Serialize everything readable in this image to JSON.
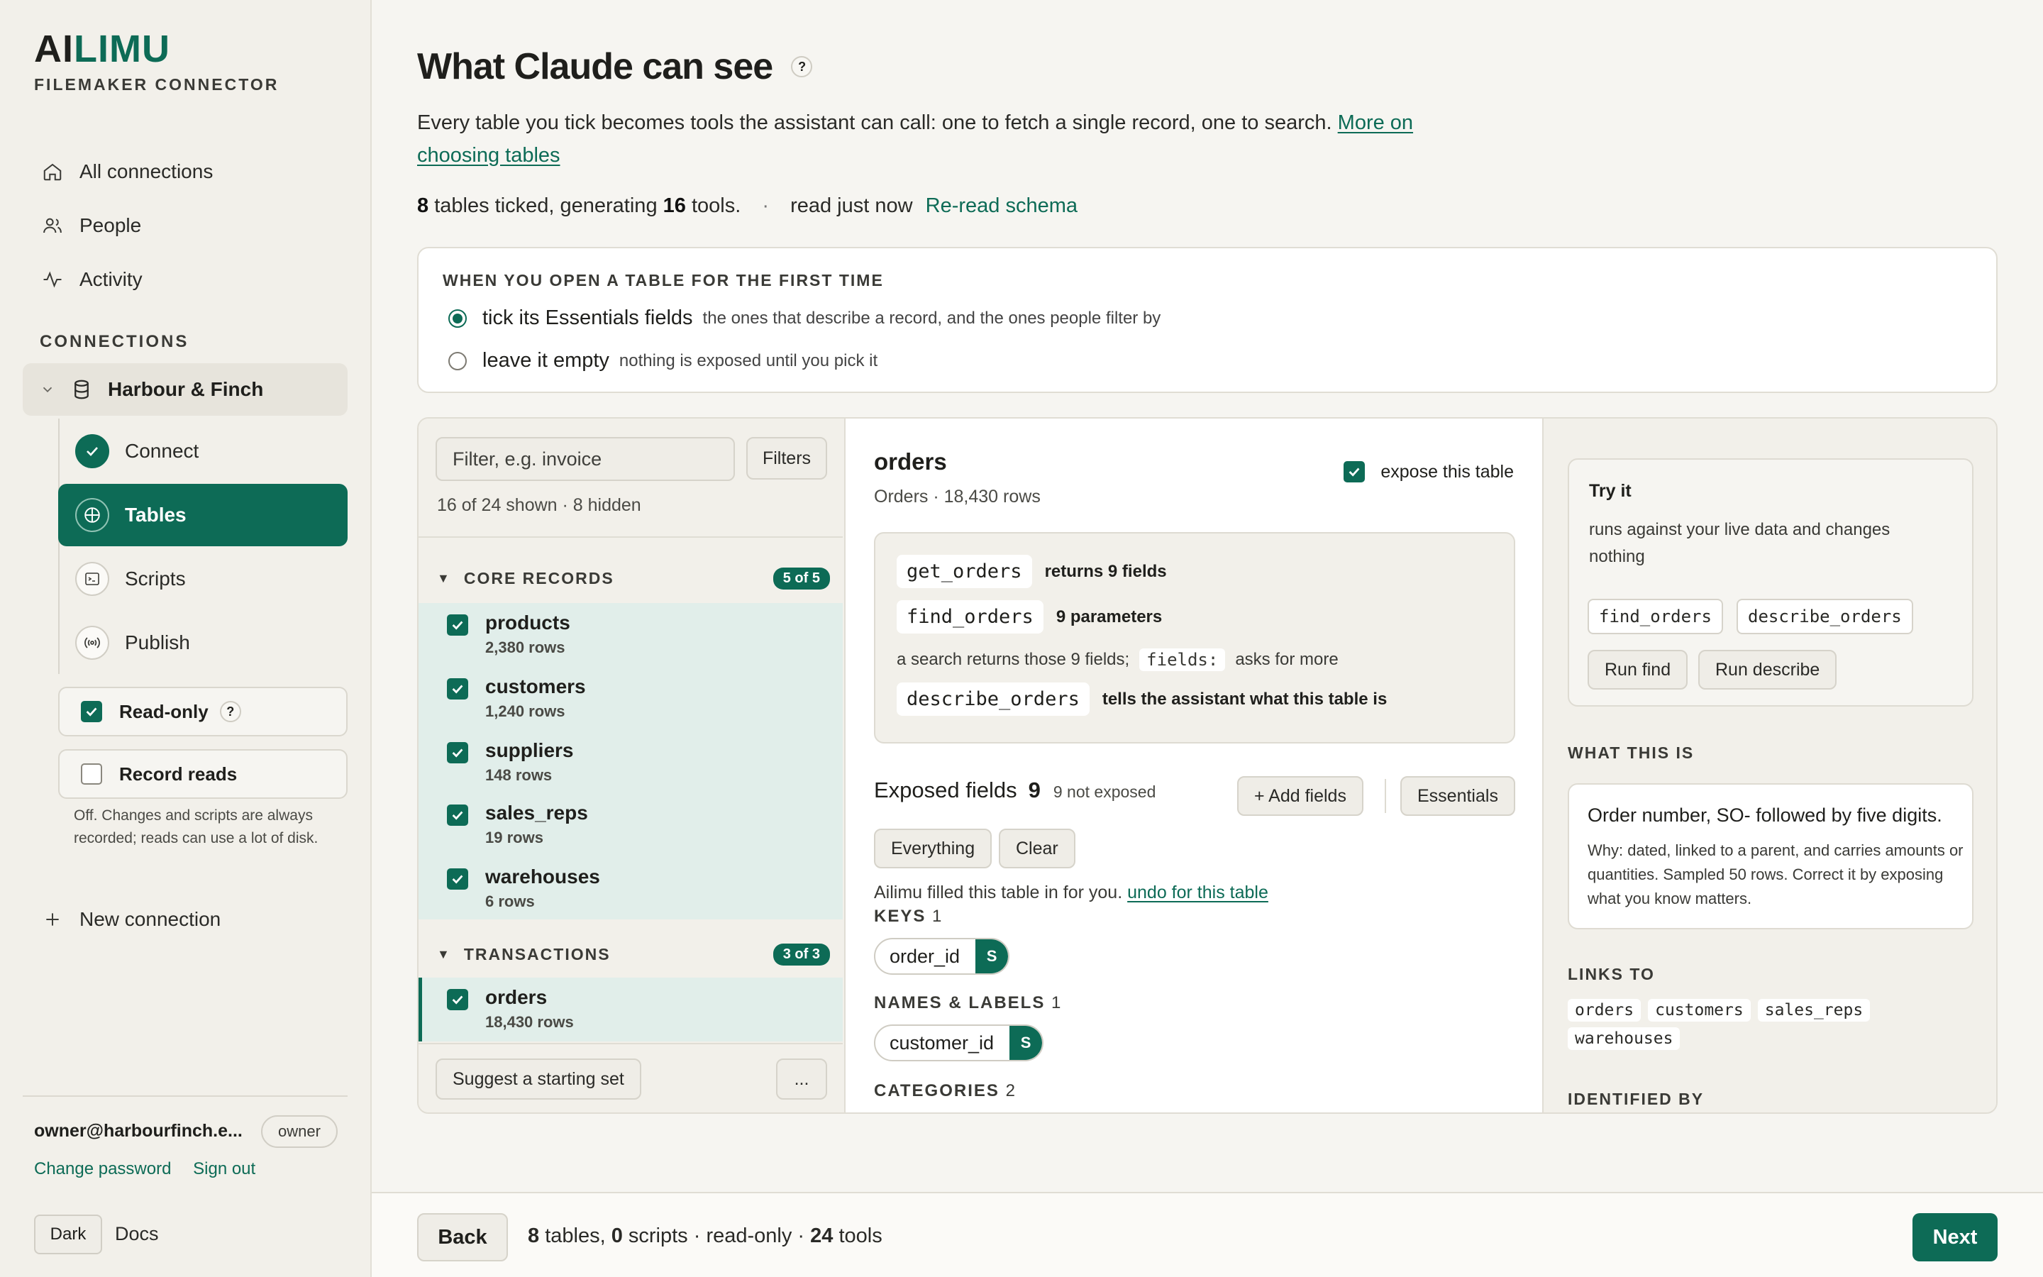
{
  "sidebar": {
    "logo_a": "AI",
    "logo_limu": "LIMU",
    "subtitle": "FILEMAKER CONNECTOR",
    "nav": [
      {
        "label": "All connections",
        "icon": "home-icon"
      },
      {
        "label": "People",
        "icon": "people-icon"
      },
      {
        "label": "Activity",
        "icon": "activity-icon"
      }
    ],
    "section_label": "CONNECTIONS",
    "connection_name": "Harbour & Finch",
    "steps": [
      {
        "label": "Connect",
        "icon": "check-icon",
        "state": "done"
      },
      {
        "label": "Tables",
        "icon": "grid-icon",
        "state": "active"
      },
      {
        "label": "Scripts",
        "icon": "terminal-icon",
        "state": "todo"
      },
      {
        "label": "Publish",
        "icon": "broadcast-icon",
        "state": "todo"
      }
    ],
    "readonly_label": "Read-only",
    "readonly_checked": true,
    "help_mark": "?",
    "record_reads_label": "Record reads",
    "record_reads_checked": false,
    "record_reads_note": "Off. Changes and scripts are always recorded; reads can use a lot of disk.",
    "new_connection": "New connection",
    "account_email": "owner@harbourfinch.e...",
    "account_role": "owner",
    "change_password": "Change password",
    "sign_out": "Sign out",
    "theme_button": "Dark",
    "docs": "Docs"
  },
  "main": {
    "title": "What Claude can see",
    "intro": "Every table you tick becomes tools the assistant can call: one to fetch a single record, one to search.",
    "intro_link": "More on choosing tables",
    "stats": {
      "tables": "8",
      "text1": " tables ticked, generating ",
      "tools": "16",
      "text2": " tools.",
      "dot": "·",
      "read": "read just now",
      "reread": "Re-read schema"
    },
    "first_time": {
      "label": "WHEN YOU OPEN A TABLE FOR THE FIRST TIME",
      "options": [
        {
          "label": "tick its Essentials fields",
          "hint": "the ones that describe a record, and the ones people filter by",
          "selected": true
        },
        {
          "label": "leave it empty",
          "hint": "nothing is exposed until you pick it",
          "selected": false
        }
      ]
    }
  },
  "table_list": {
    "filter_placeholder": "Filter, e.g. invoice",
    "filters_button": "Filters",
    "shown_text": "16 of 24 shown · 8 hidden",
    "groups": [
      {
        "name": "CORE RECORDS",
        "badge": "5 of 5",
        "tables": [
          {
            "name": "products",
            "rows": "2,380 rows",
            "checked": true
          },
          {
            "name": "customers",
            "rows": "1,240 rows",
            "checked": true
          },
          {
            "name": "suppliers",
            "rows": "148 rows",
            "checked": true
          },
          {
            "name": "sales_reps",
            "rows": "19 rows",
            "checked": true
          },
          {
            "name": "warehouses",
            "rows": "6 rows",
            "checked": true
          }
        ]
      },
      {
        "name": "TRANSACTIONS",
        "badge": "3 of 3",
        "tables": [
          {
            "name": "orders",
            "rows": "18,430 rows",
            "checked": true
          }
        ]
      }
    ],
    "suggest_button": "Suggest a starting set",
    "more_button": "..."
  },
  "detail": {
    "name": "orders",
    "subtitle": "Orders · 18,430 rows",
    "expose_label": "expose this table",
    "expose_checked": true,
    "tools": {
      "get_name": "get_orders",
      "get_desc": "returns 9 fields",
      "find_name": "find_orders",
      "find_desc": "9 parameters",
      "note_pre": "a search returns those 9 fields;",
      "note_code": "fields:",
      "note_post": "asks for more",
      "describe_name": "describe_orders",
      "describe_desc": "tells the assistant what this table is"
    },
    "exposed_label": "Exposed fields",
    "exposed_count": "9",
    "not_exposed": "9 not exposed",
    "add_fields": "+ Add fields",
    "essentials": "Essentials",
    "everything": "Everything",
    "clear": "Clear",
    "filled_text": "Ailimu filled this table in for you.",
    "undo_link": "undo for this table",
    "categories": [
      {
        "label": "KEYS",
        "count": "1",
        "field": "order_id",
        "badge": "S"
      },
      {
        "label": "NAMES & LABELS",
        "count": "1",
        "field": "customer_id",
        "badge": "S"
      },
      {
        "label": "CATEGORIES",
        "count": "2"
      }
    ]
  },
  "inspector": {
    "try_title": "Try it",
    "try_desc": "runs against your live data and changes nothing",
    "try_tools": [
      "find_orders",
      "describe_orders"
    ],
    "run_find": "Run find",
    "run_describe": "Run describe",
    "what_label": "WHAT THIS IS",
    "what_title": "Order number, SO- followed by five digits.",
    "what_desc": "Why: dated, linked to a parent, and carries amounts or quantities. Sampled 50 rows. Correct it by exposing what you know matters.",
    "links_label": "LINKS TO",
    "links": [
      "orders",
      "customers",
      "sales_reps",
      "warehouses"
    ],
    "identified_label": "IDENTIFIED BY"
  },
  "footer": {
    "back": "Back",
    "tables_count": "8",
    "tables_text": " tables, ",
    "scripts_count": "0",
    "scripts_text": " scripts · read-only · ",
    "tools_count": "24",
    "tools_text": " tools",
    "next": "Next"
  },
  "colors": {
    "accent": "#0d6b56",
    "background": "#f6f5f1"
  }
}
